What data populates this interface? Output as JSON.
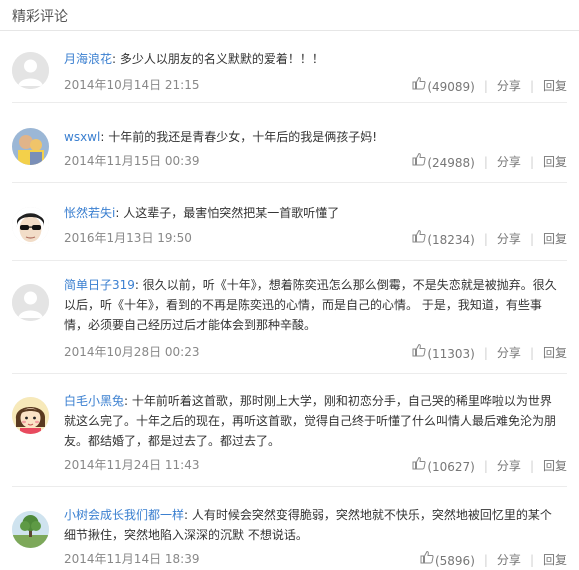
{
  "section_title": "精彩评论",
  "comments": [
    {
      "user": "月海浪花",
      "text": "多少人以朋友的名义默默的爱着！！！",
      "time": "2014年10月14日 21:15",
      "likes": "(49089)",
      "share": "分享",
      "reply": "回复",
      "avatar": "default-avatar"
    },
    {
      "user": "wsxwl",
      "text": "十年前的我还是青春少女，十年后的我是俩孩子妈!",
      "time": "2014年11月15日 00:39",
      "likes": "(24988)",
      "share": "分享",
      "reply": "回复",
      "avatar": "photo-avatar"
    },
    {
      "user": "怅然若失i",
      "text": "人这辈子，最害怕突然把某一首歌听懂了",
      "time": "2016年1月13日 19:50",
      "likes": "(18234)",
      "share": "分享",
      "reply": "回复",
      "avatar": "sunglasses-avatar"
    },
    {
      "user": "简单日子319",
      "text": "很久以前，听《十年》，想着陈奕迅怎么那么倒霉，不是失恋就是被抛弃。很久以后，听《十年》，看到的不再是陈奕迅的心情，而是自己的心情。 于是，我知道，有些事情，必须要自己经历过后才能体会到那种辛酸。",
      "time": "2014年10月28日 00:23",
      "likes": "(11303)",
      "share": "分享",
      "reply": "回复",
      "avatar": "default-avatar"
    },
    {
      "user": "白毛小黑兔",
      "text": "十年前听着这首歌，那时刚上大学，刚和初恋分手，自己哭的稀里哗啦以为世界就这么完了。十年之后的现在，再听这首歌，觉得自己终于听懂了什么叫情人最后难免沦为朋友。都结婚了，都是过去了。都过去了。",
      "time": "2014年11月24日 11:43",
      "likes": "(10627)",
      "share": "分享",
      "reply": "回复",
      "avatar": "cartoon-girl-avatar"
    },
    {
      "user": "小树会成长我们都一样",
      "text": "人有时候会突然变得脆弱，突然地就不快乐，突然地被回忆里的某个细节揪住，突然地陷入深深的沉默 不想说话。",
      "time": "2014年11月14日 18:39",
      "likes": "(5896)",
      "share": "分享",
      "reply": "回复",
      "avatar": "tree-avatar"
    }
  ],
  "colors": {
    "username": "#3a7fd0",
    "meta": "#888888"
  }
}
